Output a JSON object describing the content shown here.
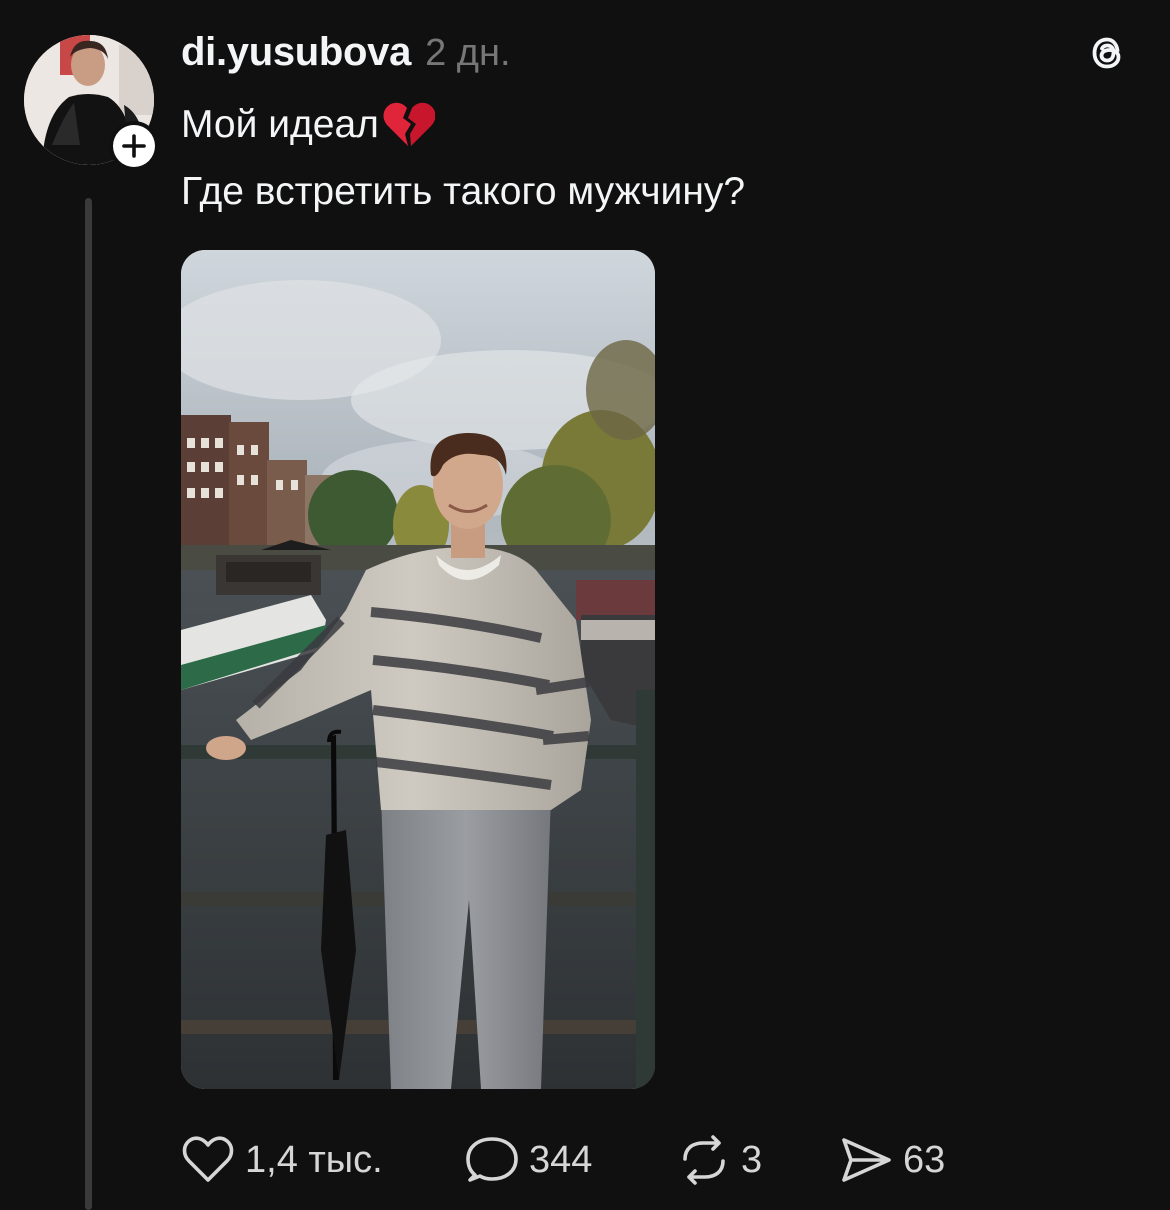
{
  "post": {
    "username": "di.yusubova",
    "timestamp": "2 дн.",
    "caption_line1": "Мой идеал",
    "caption_line2": "Где встретить такого мужчину?"
  },
  "icons": {
    "avatar": "profile-photo",
    "follow": "plus-icon",
    "app": "threads-logo-icon",
    "caption_emoji": "broken-heart-icon",
    "like": "heart-outline-icon",
    "comment": "speech-bubble-icon",
    "repost": "repost-arrows-icon",
    "share": "paper-plane-icon"
  },
  "stats": {
    "likes": "1,4 тыс.",
    "comments": "344",
    "reposts": "3",
    "shares": "63"
  },
  "colors": {
    "background": "#101010",
    "text": "#f3f5f7",
    "muted": "#777777",
    "heart_red": "#e0243a"
  }
}
